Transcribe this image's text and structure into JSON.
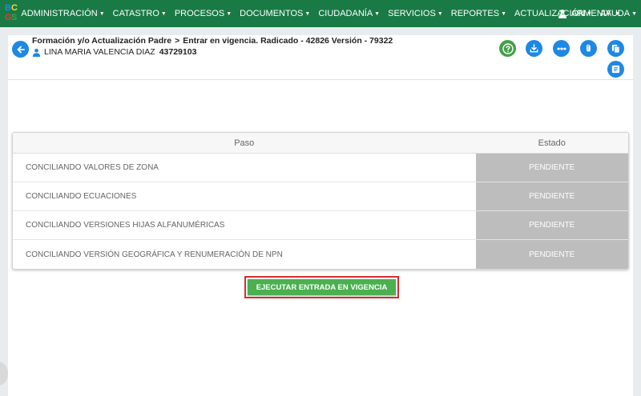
{
  "logo": {
    "letters": [
      "B",
      "C",
      "G",
      "S"
    ],
    "colors": [
      "#1e88e5",
      "#fdd835",
      "#e53935",
      "#43a047"
    ]
  },
  "nav": {
    "items": [
      {
        "label": "ADMINISTRACIÓN"
      },
      {
        "label": "CATASTRO"
      },
      {
        "label": "PROCESOS"
      },
      {
        "label": "DOCUMENTOS"
      },
      {
        "label": "CIUDADANÍA"
      },
      {
        "label": "SERVICIOS"
      },
      {
        "label": "REPORTES"
      },
      {
        "label": "ACTUALIZACIÓN"
      },
      {
        "label": "AYUDA"
      }
    ],
    "user": "ARMENIA"
  },
  "header": {
    "breadcrumb_1": "Formación y/o Actualización Padre",
    "breadcrumb_sep": ">",
    "breadcrumb_2": "Entrar en vigencia. Radicado - 42826 Versión - 79322",
    "person_name": "LINA MARIA VALENCIA DIAZ",
    "person_doc": "43729103"
  },
  "toolbar": {
    "icons": [
      "help-icon",
      "download-icon",
      "more-icon",
      "attachment-icon",
      "copy-icon",
      "list-icon"
    ]
  },
  "table": {
    "columns": [
      "Paso",
      "Estado"
    ],
    "rows": [
      {
        "paso": "CONCILIANDO VALORES DE ZONA",
        "estado": "PENDIENTE"
      },
      {
        "paso": "CONCILIANDO ECUACIONES",
        "estado": "PENDIENTE"
      },
      {
        "paso": "CONCILIANDO VERSIONES HIJAS ALFANUMÉRICAS",
        "estado": "PENDIENTE"
      },
      {
        "paso": "CONCILIANDO VERSIÓN GEOGRÁFICA Y RENUMERACIÓN DE NPN",
        "estado": "PENDIENTE"
      }
    ]
  },
  "actions": {
    "execute_label": "EJECUTAR ENTRADA EN VIGENCIA"
  },
  "colors": {
    "nav": "#197a46",
    "accent": "#1e88e5",
    "success": "#4caf50",
    "pending": "#bdbdbd",
    "highlight": "#d32f2f"
  }
}
